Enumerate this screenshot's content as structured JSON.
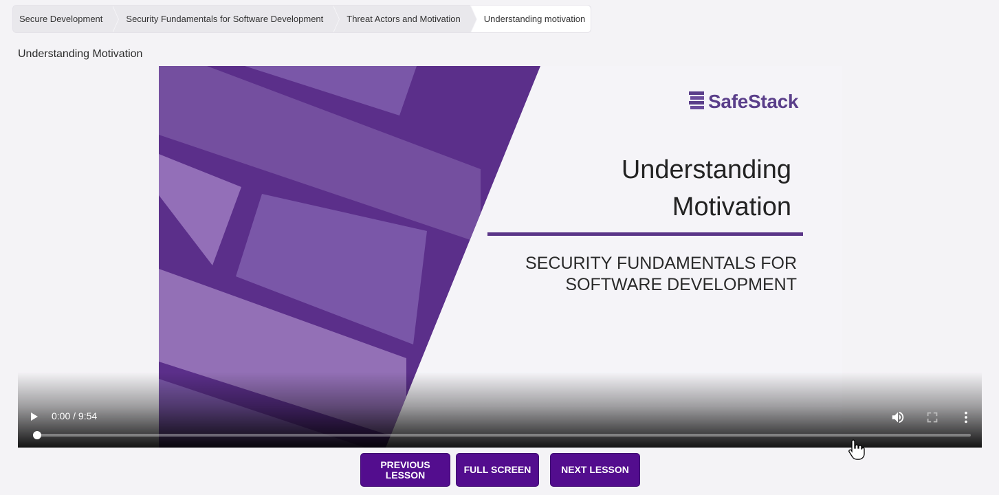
{
  "breadcrumb": {
    "items": [
      {
        "label": "Secure Development"
      },
      {
        "label": "Security Fundamentals for Software Development"
      },
      {
        "label": "Threat Actors and Motivation"
      },
      {
        "label": "Understanding motivation"
      }
    ]
  },
  "lesson": {
    "title": "Understanding Motivation"
  },
  "slide": {
    "logo_text": "SafeStack",
    "heading_line1": "Understanding",
    "heading_line2": "Motivation",
    "sub_line1": "SECURITY FUNDAMENTALS FOR",
    "sub_line2": "SOFTWARE DEVELOPMENT"
  },
  "video": {
    "time": "0:00 / 9:54",
    "progress": 0.0,
    "icons": {
      "play": "play-icon",
      "volume": "volume-icon",
      "fullscreen": "fullscreen-icon",
      "more": "more-vert-icon"
    }
  },
  "buttons": {
    "previous_line1": "PREVIOUS",
    "previous_line2": "LESSON",
    "full_screen": "FULL SCREEN",
    "next": "NEXT LESSON"
  },
  "colors": {
    "accent": "#530d8e",
    "slide_purple": "#5a3588",
    "background": "#f4f3f6"
  }
}
